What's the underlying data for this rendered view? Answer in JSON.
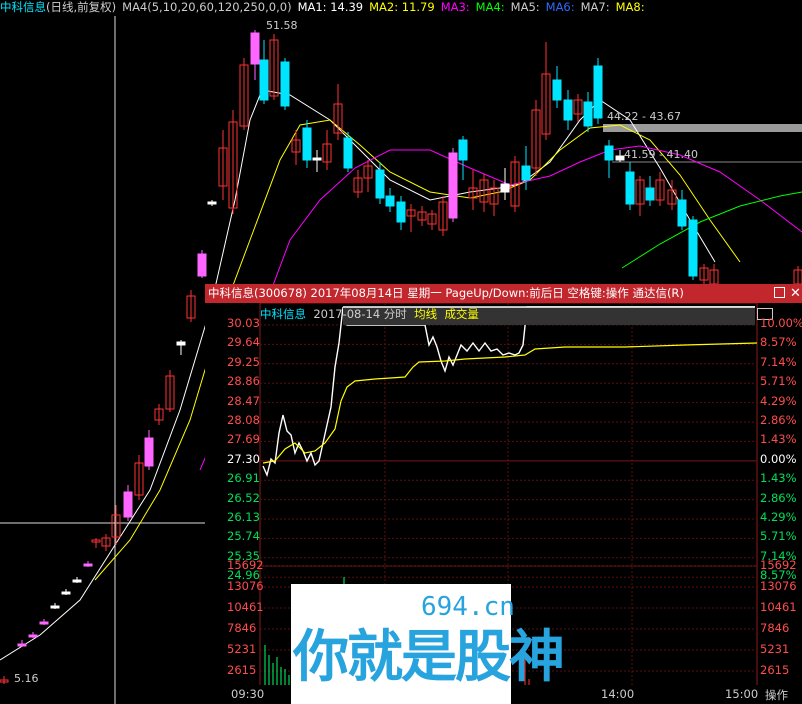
{
  "header": {
    "stock_name": "中科信息",
    "mode": "(日线,前复权)",
    "ma_set_label": "MA4(5,10,20,60,120,250,0,0)",
    "ma1": "MA1: 14.39",
    "ma2": "MA2: 11.79",
    "ma3": "MA3:",
    "ma4": "MA4:",
    "ma5": "MA5:",
    "ma6": "MA6:",
    "ma7": "MA7:",
    "ma8": "MA8:",
    "colors": {
      "ma1": "#ffffff",
      "ma2": "#ffff00",
      "ma3": "#ff00ff",
      "ma4": "#00ff00",
      "ma5": "#cccccc",
      "ma6": "#2f6bff",
      "ma7": "#cccccc",
      "ma8": "#ffff00",
      "up": "#ff3333",
      "down": "#00e5ff",
      "limit_up": "#ff66ff"
    }
  },
  "daily": {
    "price_high_label": "51.58",
    "price_low_label": "5.16",
    "level_labels": [
      "44.22 - 43.67",
      "41.59 - 41.40"
    ]
  },
  "popup": {
    "title": "中科信息(300678) 2017年08月14日 星期一 PageUp/Down:前后日 空格键:操作 通达信(R)",
    "sub_name": "中科信息",
    "sub_date": "2017-08-14 分时",
    "sub_avg": "均线",
    "sub_vol": "成交量",
    "price_labels": [
      "30.03",
      "29.64",
      "29.25",
      "28.86",
      "28.47",
      "28.08",
      "27.69",
      "27.30",
      "26.91",
      "26.52",
      "26.13",
      "25.74",
      "25.35",
      "24.96"
    ],
    "pct_labels": [
      "10.00%",
      "8.57%",
      "7.14%",
      "5.71%",
      "4.29%",
      "2.86%",
      "1.43%",
      "0.00%",
      "1.43%",
      "2.86%",
      "4.29%",
      "5.71%",
      "7.14%",
      "8.57%"
    ],
    "vol_labels": [
      "15692",
      "13076",
      "10461",
      "7846",
      "5231",
      "2615"
    ],
    "time_labels": [
      "09:30",
      "14:00",
      "15:00"
    ],
    "corner_label": "操作"
  },
  "watermark": {
    "url": "694.cn",
    "text": "你就是股神"
  }
}
